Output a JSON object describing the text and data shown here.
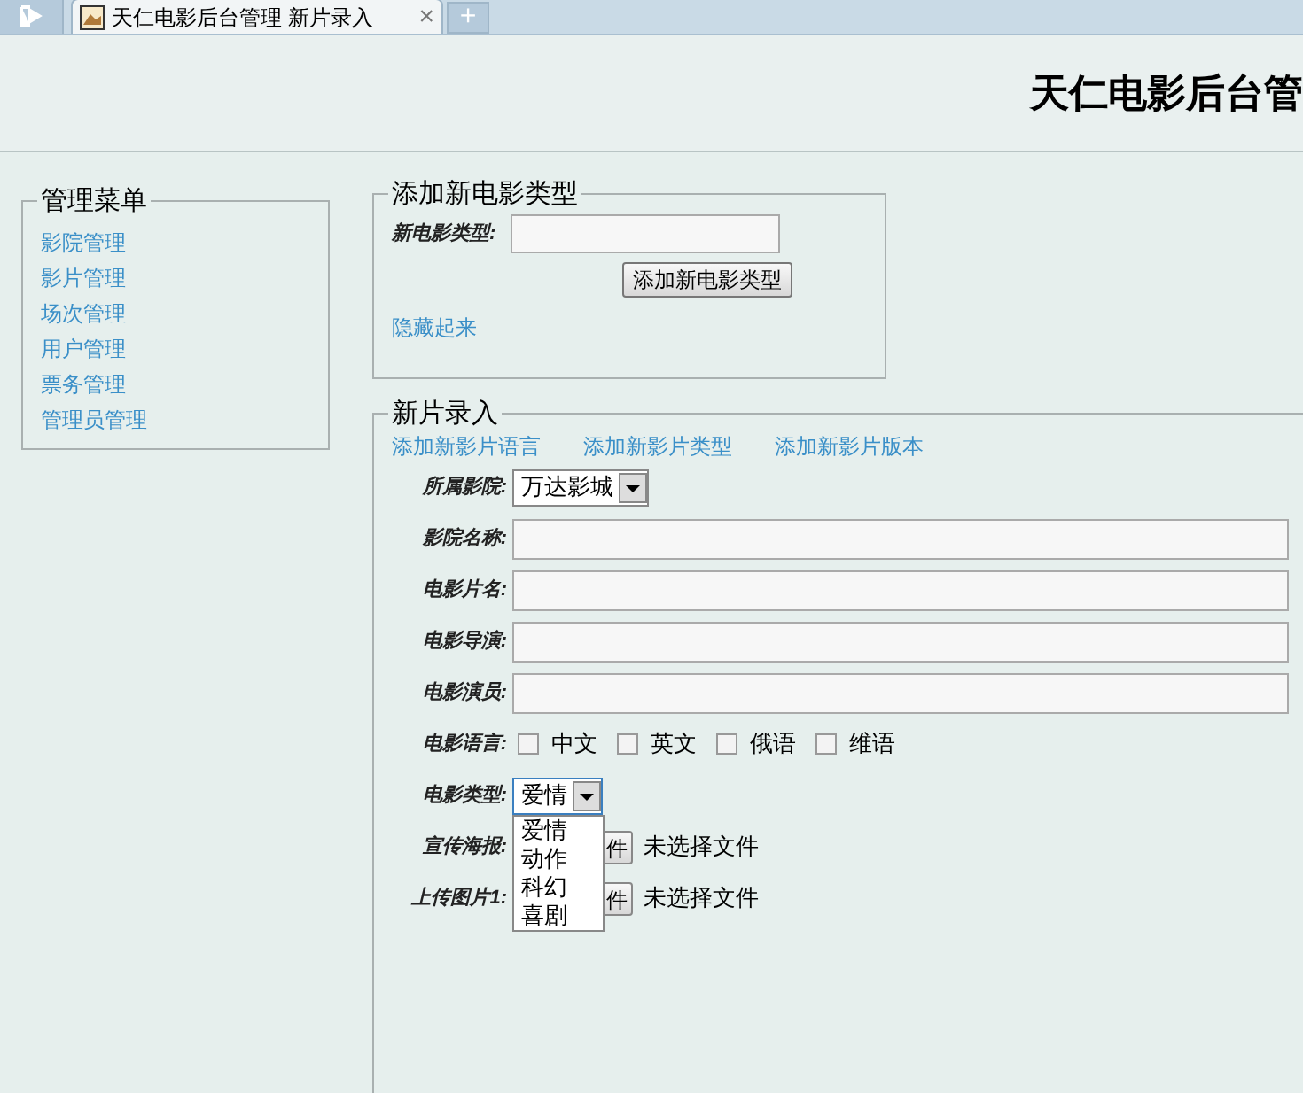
{
  "tabs": [
    {
      "title": "天仁电影后台管理 新片录入",
      "close": "×",
      "selected": true
    }
  ],
  "new_tab_button": "+",
  "header": {
    "title": "天仁电影后台管"
  },
  "menu": {
    "legend": "管理菜单",
    "items": [
      "影院管理",
      "影片管理",
      "场次管理",
      "用户管理",
      "票务管理",
      "管理员管理"
    ]
  },
  "add_type": {
    "legend": "添加新电影类型",
    "label": "新电影类型:",
    "button": "添加新电影类型",
    "hide_link": "隐藏起来"
  },
  "new_movie": {
    "legend": "新片录入",
    "links": [
      "添加新影片语言",
      "添加新影片类型",
      "添加新影片版本"
    ],
    "fields": [
      {
        "kind": "select",
        "label": "所属影院:",
        "value": "万达影城"
      },
      {
        "kind": "text",
        "label": "影院名称:"
      },
      {
        "kind": "text",
        "label": "电影片名:"
      },
      {
        "kind": "text",
        "label": "电影导演:"
      },
      {
        "kind": "text",
        "label": "电影演员:"
      },
      {
        "kind": "checkboxes",
        "label": "电影语言:",
        "options": [
          {
            "label": "中文",
            "checked": false
          },
          {
            "label": "英文",
            "checked": false
          },
          {
            "label": "俄语",
            "checked": false
          },
          {
            "label": "维语",
            "checked": false
          }
        ]
      },
      {
        "kind": "select",
        "label": "电影类型:",
        "value": "爱情",
        "expanded": true,
        "options": [
          "爱情",
          "动作",
          "科幻",
          "喜剧"
        ]
      },
      {
        "kind": "file",
        "label": "宣传海报:",
        "button": "件",
        "status": "未选择文件"
      },
      {
        "kind": "file",
        "label": "上传图片1:",
        "button": "件",
        "status": "未选择文件"
      }
    ]
  }
}
